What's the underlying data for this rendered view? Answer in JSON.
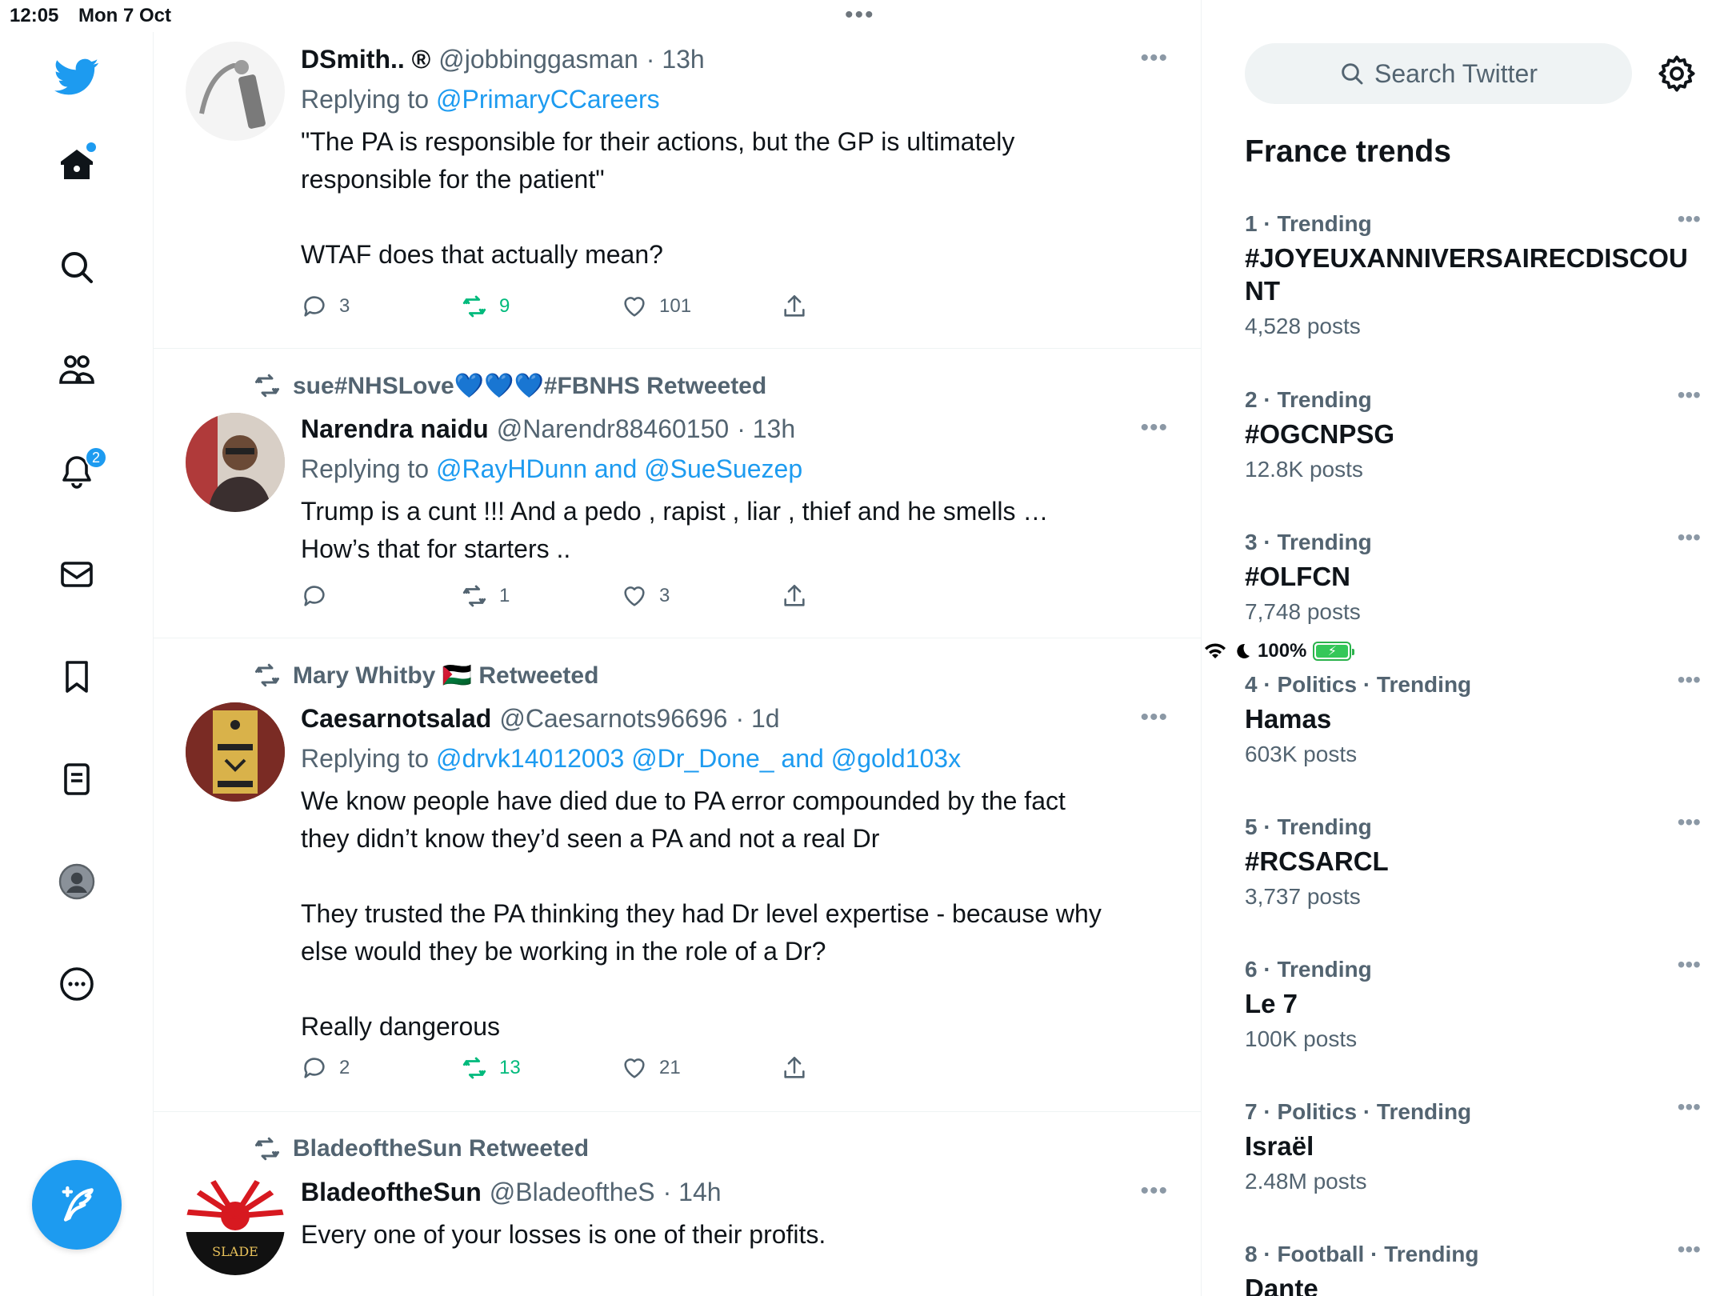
{
  "status": {
    "time": "12:05",
    "date": "Mon 7 Oct",
    "battery": "100%",
    "dots": "•••"
  },
  "nav": {
    "notifications_badge": "2"
  },
  "tweets": [
    {
      "name": "DSmith.. ®",
      "handle": "@jobbinggasman",
      "time": "· 13h",
      "reply_prefix": "Replying to",
      "mentions": "@PrimaryCCareers",
      "lines": [
        "\"The PA is responsible for their actions, but the GP is ultimately",
        "responsible for the patient\"",
        "",
        "WTAF does that actually mean?"
      ],
      "replies": "3",
      "retweets": "9",
      "likes": "101"
    },
    {
      "retweeted_by": "sue#NHSLove💙💙💙#FBNHS Retweeted",
      "name": "Narendra naidu",
      "handle": "@Narendr88460150",
      "time": "· 13h",
      "reply_prefix": "Replying to",
      "mentions": "@RayHDunn and @SueSuezep",
      "lines": [
        "Trump is a cunt !!! And a pedo , rapist , liar , thief and he smells …",
        "How’s that for starters .."
      ],
      "replies": "",
      "retweets": "1",
      "likes": "3"
    },
    {
      "retweeted_by": "Mary Whitby 🇵🇸 Retweeted",
      "name": "Caesarnotsalad",
      "handle": "@Caesarnots96696",
      "time": "· 1d",
      "reply_prefix": "Replying to",
      "mentions": "@drvk14012003 @Dr_Done_ and @gold103x",
      "lines": [
        "We know people have died due to PA error compounded by the fact",
        "they didn’t know they’d seen a PA and not a real Dr",
        "",
        "They trusted the PA thinking they had Dr level expertise - because why",
        "else would they be working in the role of a Dr?",
        "",
        "Really dangerous"
      ],
      "replies": "2",
      "retweets": "13",
      "likes": "21"
    },
    {
      "retweeted_by": "BladeoftheSun Retweeted",
      "name": "BladeoftheSun",
      "handle": "@BladeoftheS",
      "time": "· 14h",
      "lines": [
        "Every one of your losses is one of their profits."
      ]
    }
  ],
  "sidebar": {
    "search_placeholder": "Search Twitter",
    "trends_title": "France trends",
    "trends": [
      {
        "meta": "1 · Trending",
        "name": "#JOYEUXANNIVERSAIRECDISCOUNT",
        "posts": "4,528 posts"
      },
      {
        "meta": "2 · Trending",
        "name": "#OGCNPSG",
        "posts": "12.8K posts"
      },
      {
        "meta": "3 · Trending",
        "name": "#OLFCN",
        "posts": "7,748 posts"
      },
      {
        "meta": "4 · Politics · Trending",
        "name": "Hamas",
        "posts": "603K posts"
      },
      {
        "meta": "5 · Trending",
        "name": "#RCSARCL",
        "posts": "3,737 posts"
      },
      {
        "meta": "6 · Trending",
        "name": "Le 7",
        "posts": "100K posts"
      },
      {
        "meta": "7 · Politics · Trending",
        "name": "Israël",
        "posts": "2.48M posts"
      },
      {
        "meta": "8 · Football · Trending",
        "name": "Dante",
        "posts": ""
      }
    ]
  },
  "colors": {
    "accent": "#1d9bf0",
    "retweet_green": "#00ba7c",
    "secondary_text": "#536471"
  }
}
